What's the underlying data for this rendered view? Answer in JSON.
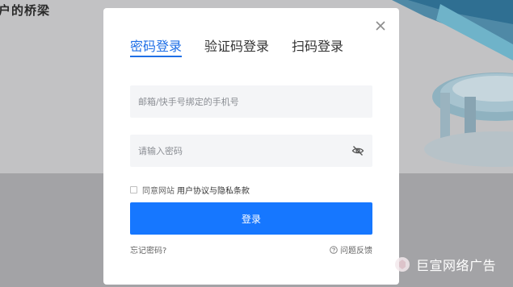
{
  "background": {
    "title_partial": "户的桥梁"
  },
  "login_dialog": {
    "tabs": [
      {
        "label": "密码登录",
        "active": true
      },
      {
        "label": "验证码登录",
        "active": false
      },
      {
        "label": "扫码登录",
        "active": false
      }
    ],
    "phone_field": {
      "placeholder": "邮箱/快手号绑定的手机号",
      "value": ""
    },
    "password_field": {
      "placeholder": "请输入密码",
      "value": ""
    },
    "agreement": {
      "prefix": "同意网站",
      "link_label": "用户协议与隐私条款",
      "checked": false
    },
    "submit_label": "登录",
    "forgot_label": "忘记密码?",
    "feedback_label": "问题反馈",
    "accent_color": "#1677ff",
    "icons": {
      "close": "close-icon",
      "password_visibility": "eye-off-icon",
      "help": "help-circle-icon"
    }
  },
  "watermark": {
    "text": "巨宣网络广告"
  }
}
